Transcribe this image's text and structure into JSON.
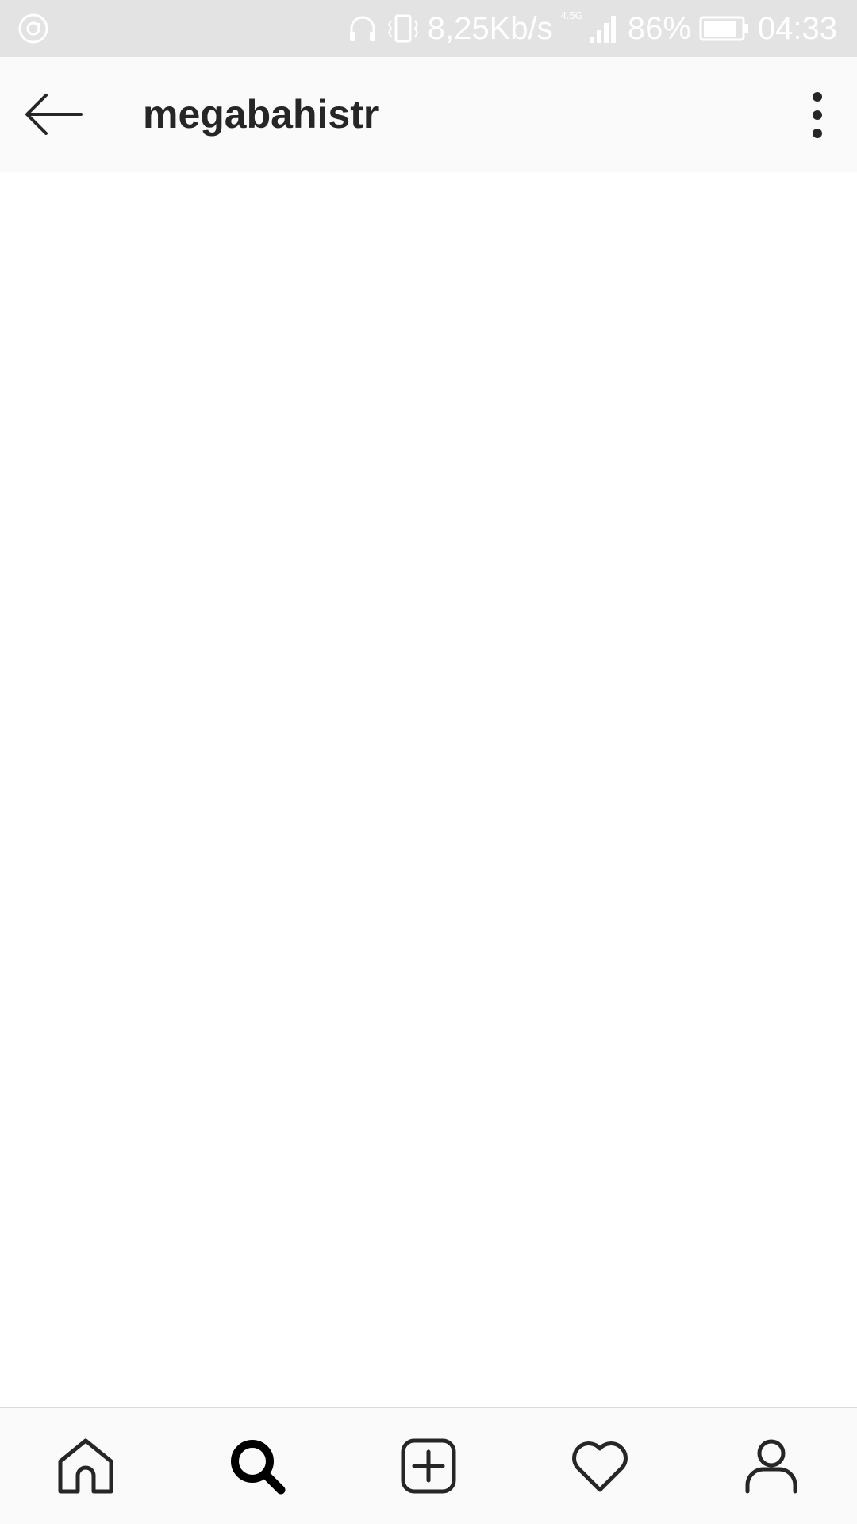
{
  "status_bar": {
    "network_speed": "8,25Kb/s",
    "network_type": "4.5G",
    "battery_percent": "86%",
    "battery_level": 0.86,
    "time": "04:33",
    "icons": [
      "music-icon",
      "headphones-icon",
      "vibrate-icon",
      "signal-icon",
      "battery-icon"
    ]
  },
  "app_bar": {
    "title": "megabahistr",
    "back_icon": "arrow-left-icon",
    "menu_icon": "more-vertical-icon"
  },
  "bottom_nav": {
    "items": [
      {
        "name": "home",
        "icon": "home-icon",
        "active": false
      },
      {
        "name": "search",
        "icon": "search-icon",
        "active": true
      },
      {
        "name": "new-post",
        "icon": "add-post-icon",
        "active": false
      },
      {
        "name": "activity",
        "icon": "heart-icon",
        "active": false
      },
      {
        "name": "profile",
        "icon": "profile-icon",
        "active": false
      }
    ]
  },
  "colors": {
    "status_bar_bg": "#e3e3e3",
    "app_bar_bg": "#fafafa",
    "text_primary": "#262626",
    "divider": "#dbdbdb"
  }
}
